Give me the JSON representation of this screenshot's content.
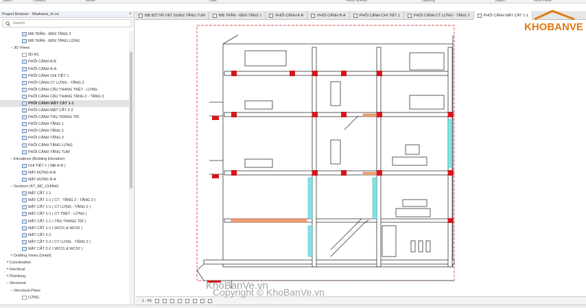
{
  "ribbon": [
    "Select",
    "Creation",
    "Model",
    "Data",
    "Room & Area",
    "Opening",
    "Datum",
    "Work Plane"
  ],
  "browser": {
    "title": "Project Browser - Nhahanoi_r6.rvt",
    "close": "×",
    "search_placeholder": "Search"
  },
  "tree": [
    {
      "indent": 4,
      "exp": "",
      "icon": "view",
      "label": "MB TRẦN - ĐÈN TẦNG 3"
    },
    {
      "indent": 4,
      "exp": "",
      "icon": "view",
      "label": "MB TRẦN - ĐÈN TẦNG LỬNG"
    },
    {
      "indent": 2,
      "exp": "−",
      "icon": "",
      "label": "3D Views"
    },
    {
      "indent": 4,
      "exp": "",
      "icon": "check",
      "label": "3D KC"
    },
    {
      "indent": 4,
      "exp": "",
      "icon": "view",
      "label": "PHỐI CẢNH A-B"
    },
    {
      "indent": 4,
      "exp": "",
      "icon": "view",
      "label": "PHỐI CẢNH B-A"
    },
    {
      "indent": 4,
      "exp": "",
      "icon": "view",
      "label": "PHỐI CẢNH CHI TIẾT 1"
    },
    {
      "indent": 4,
      "exp": "",
      "icon": "view",
      "label": "PHỐI CẢNH CT LỬNG - TẦNG 2"
    },
    {
      "indent": 4,
      "exp": "",
      "icon": "view",
      "label": "PHỐI CẢNH CẦU THANG TRỆT - LỬNG"
    },
    {
      "indent": 4,
      "exp": "",
      "icon": "view",
      "label": "PHỐI CẢNH CẦU THANG TẦNG 2 - TẦNG 3"
    },
    {
      "indent": 4,
      "exp": "",
      "icon": "view",
      "label": "PHỐI CẢNH MẶT CẮT 1-1",
      "selected": true
    },
    {
      "indent": 4,
      "exp": "",
      "icon": "view",
      "label": "PHỐI CẢNH MẶT CẮT 2-2"
    },
    {
      "indent": 4,
      "exp": "",
      "icon": "view",
      "label": "PHỐI CẢNH TRỤ TRANG TRÍ"
    },
    {
      "indent": 4,
      "exp": "",
      "icon": "view",
      "label": "PHỐI CẢNH TẦNG 1"
    },
    {
      "indent": 4,
      "exp": "",
      "icon": "view",
      "label": "PHỐI CẢNH TẦNG 2"
    },
    {
      "indent": 4,
      "exp": "",
      "icon": "view",
      "label": "PHỐI CẢNH TẦNG 3"
    },
    {
      "indent": 4,
      "exp": "",
      "icon": "view",
      "label": "PHỐI CẢNH TẦNG LỬNG"
    },
    {
      "indent": 4,
      "exp": "",
      "icon": "view",
      "label": "PHỐI CẢNH TẦNG TUM"
    },
    {
      "indent": 2,
      "exp": "−",
      "icon": "",
      "label": "Elevations (Building Elevation)"
    },
    {
      "indent": 4,
      "exp": "",
      "icon": "view",
      "label": "CHI TIẾT 1 ( MĐ A-B )"
    },
    {
      "indent": 4,
      "exp": "",
      "icon": "view",
      "label": "MẶT ĐỨNG A-B"
    },
    {
      "indent": 4,
      "exp": "",
      "icon": "view",
      "label": "MẶT ĐỨNG B-A"
    },
    {
      "indent": 2,
      "exp": "−",
      "icon": "",
      "label": "Sections (KT_MC_CHINH)"
    },
    {
      "indent": 4,
      "exp": "",
      "icon": "view",
      "label": "MẶT CẮT 1-1"
    },
    {
      "indent": 4,
      "exp": "",
      "icon": "view",
      "label": "MẶT CẮT 1-1 ( CT - TẦNG 2 - TẦNG 3 )"
    },
    {
      "indent": 4,
      "exp": "",
      "icon": "view",
      "label": "MẶT CẮT 1-1 ( CT LỬNG - TẦNG 2 )"
    },
    {
      "indent": 4,
      "exp": "",
      "icon": "view",
      "label": "MẶT CẮT 1-1 ( CT TRỆT - LỬNG )"
    },
    {
      "indent": 4,
      "exp": "",
      "icon": "view",
      "label": "MẶT CẮT 1-1 ( TRỤ TRANG TRÍ )"
    },
    {
      "indent": 4,
      "exp": "",
      "icon": "view",
      "label": "MẶT CẮT 1-1 ( WC01 & WC02 )"
    },
    {
      "indent": 4,
      "exp": "",
      "icon": "view",
      "label": "MẶT CẮT 2-2"
    },
    {
      "indent": 4,
      "exp": "",
      "icon": "view",
      "label": "MẶT CẮT 2-2 ( CT LỬNG - TẦNG 2 )"
    },
    {
      "indent": 4,
      "exp": "",
      "icon": "view",
      "label": "MẶT CẮT 2-2 ( WC01 & WC02 )"
    },
    {
      "indent": 2,
      "exp": "+",
      "icon": "",
      "label": "Drafting Views (Detail)"
    },
    {
      "indent": 1,
      "exp": "+",
      "icon": "",
      "label": "Coordination"
    },
    {
      "indent": 1,
      "exp": "+",
      "icon": "",
      "label": "Electrical"
    },
    {
      "indent": 1,
      "exp": "+",
      "icon": "",
      "label": "Plumbing"
    },
    {
      "indent": 1,
      "exp": "−",
      "icon": "",
      "label": "Structural"
    },
    {
      "indent": 2,
      "exp": "−",
      "icon": "",
      "label": "Structural Plans"
    },
    {
      "indent": 4,
      "exp": "",
      "icon": "check",
      "label": "LỬNG"
    }
  ],
  "tabs": [
    {
      "label": "MB BỐ TRÍ VẬT DỤNG TẦNG TUM"
    },
    {
      "label": "MB TRẦN - ĐÈN TẦNG 1"
    },
    {
      "label": "PHỐI CẢNH A-B"
    },
    {
      "label": "PHỐI CẢNH B-A"
    },
    {
      "label": "PHỐI CẢNH CHI TIẾT 1"
    },
    {
      "label": "PHỐI CẢNH CT LỬNG - TẦNG 2"
    },
    {
      "label": "PHỐI CẢNH MẶT CẮT 1-1",
      "active": true
    }
  ],
  "view": {
    "scale": "1 : 65"
  },
  "logo": {
    "text": "KHOBANVE",
    "color": "#e07a10"
  },
  "watermarks": [
    "KhoBanVe.vn",
    "Copyright © KhoBanVe.vn"
  ],
  "colors": {
    "beam": "#d9141b",
    "glass": "#7fe3e6",
    "slab": "#f0a070",
    "line": "#333333"
  }
}
